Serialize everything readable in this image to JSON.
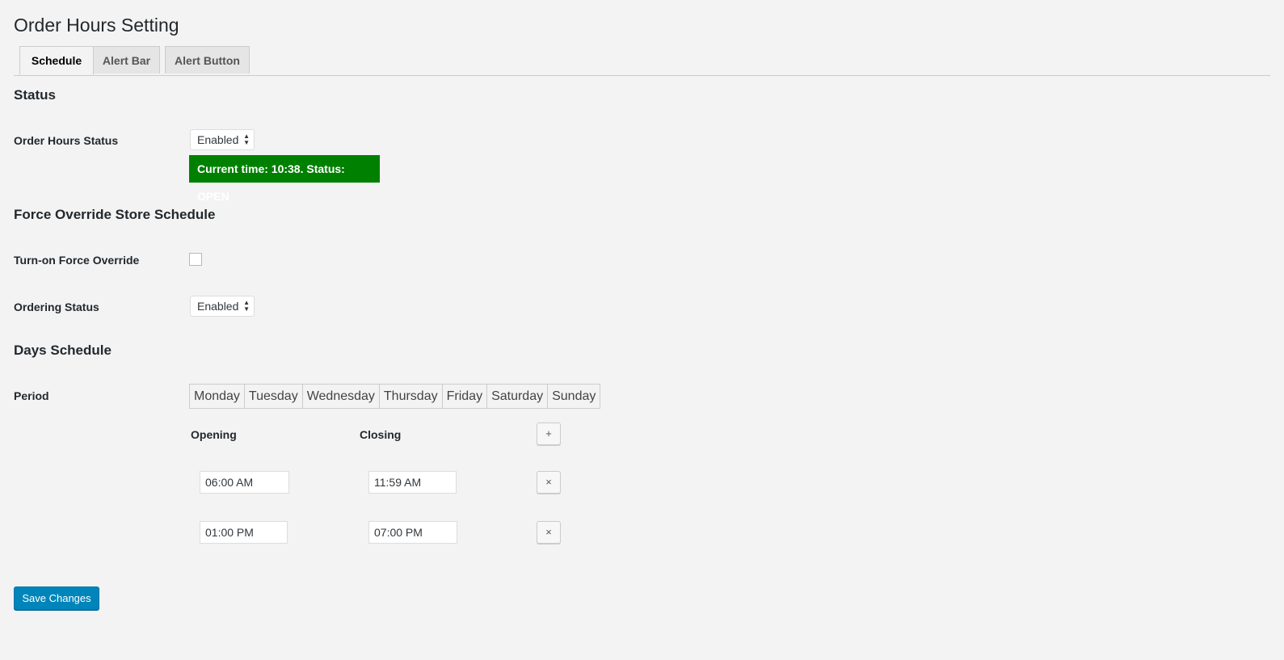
{
  "page": {
    "title": "Order Hours Setting"
  },
  "tabs": [
    {
      "label": "Schedule",
      "active": true
    },
    {
      "label": "Alert Bar",
      "active": false
    },
    {
      "label": "Alert Button",
      "active": false
    }
  ],
  "status_section": {
    "title": "Status",
    "order_hours_status_label": "Order Hours Status",
    "order_hours_status_value": "Enabled",
    "current_status_text": "Current time: 10:38. Status: OPEN",
    "current_status_color": "#008000"
  },
  "override_section": {
    "title": "Force Override Store Schedule",
    "turn_on_label": "Turn-on Force Override",
    "turn_on_checked": false,
    "ordering_status_label": "Ordering Status",
    "ordering_status_value": "Enabled"
  },
  "days_section": {
    "title": "Days Schedule",
    "period_label": "Period",
    "days": [
      "Monday",
      "Tuesday",
      "Wednesday",
      "Thursday",
      "Friday",
      "Saturday",
      "Sunday"
    ],
    "opening_header": "Opening",
    "closing_header": "Closing",
    "add_symbol": "+",
    "remove_symbol": "×",
    "periods": [
      {
        "opening": "06:00 AM",
        "closing": "11:59 AM"
      },
      {
        "opening": "01:00 PM",
        "closing": "07:00 PM"
      }
    ]
  },
  "actions": {
    "save_label": "Save Changes",
    "accent_color": "#0085ba"
  }
}
